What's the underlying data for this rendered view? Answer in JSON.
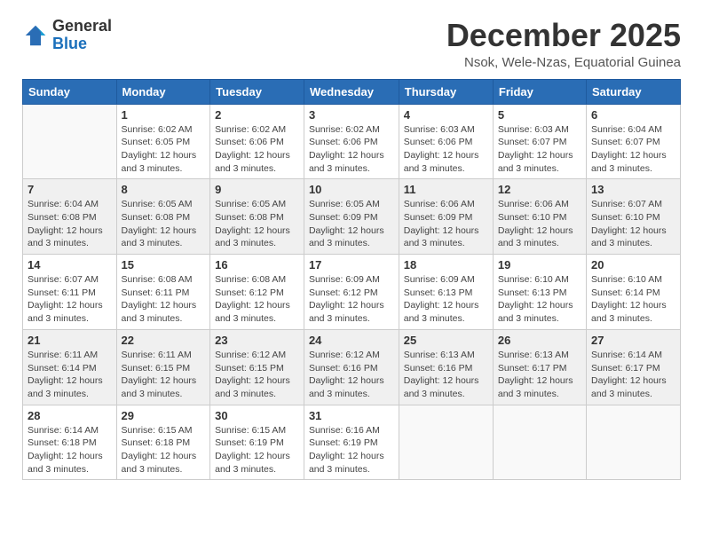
{
  "logo": {
    "general": "General",
    "blue": "Blue"
  },
  "header": {
    "month": "December 2025",
    "location": "Nsok, Wele-Nzas, Equatorial Guinea"
  },
  "days_of_week": [
    "Sunday",
    "Monday",
    "Tuesday",
    "Wednesday",
    "Thursday",
    "Friday",
    "Saturday"
  ],
  "weeks": [
    [
      {
        "day": "",
        "info": ""
      },
      {
        "day": "1",
        "info": "Sunrise: 6:02 AM\nSunset: 6:05 PM\nDaylight: 12 hours\nand 3 minutes."
      },
      {
        "day": "2",
        "info": "Sunrise: 6:02 AM\nSunset: 6:06 PM\nDaylight: 12 hours\nand 3 minutes."
      },
      {
        "day": "3",
        "info": "Sunrise: 6:02 AM\nSunset: 6:06 PM\nDaylight: 12 hours\nand 3 minutes."
      },
      {
        "day": "4",
        "info": "Sunrise: 6:03 AM\nSunset: 6:06 PM\nDaylight: 12 hours\nand 3 minutes."
      },
      {
        "day": "5",
        "info": "Sunrise: 6:03 AM\nSunset: 6:07 PM\nDaylight: 12 hours\nand 3 minutes."
      },
      {
        "day": "6",
        "info": "Sunrise: 6:04 AM\nSunset: 6:07 PM\nDaylight: 12 hours\nand 3 minutes."
      }
    ],
    [
      {
        "day": "7",
        "info": "Sunrise: 6:04 AM\nSunset: 6:08 PM\nDaylight: 12 hours\nand 3 minutes."
      },
      {
        "day": "8",
        "info": "Sunrise: 6:05 AM\nSunset: 6:08 PM\nDaylight: 12 hours\nand 3 minutes."
      },
      {
        "day": "9",
        "info": "Sunrise: 6:05 AM\nSunset: 6:08 PM\nDaylight: 12 hours\nand 3 minutes."
      },
      {
        "day": "10",
        "info": "Sunrise: 6:05 AM\nSunset: 6:09 PM\nDaylight: 12 hours\nand 3 minutes."
      },
      {
        "day": "11",
        "info": "Sunrise: 6:06 AM\nSunset: 6:09 PM\nDaylight: 12 hours\nand 3 minutes."
      },
      {
        "day": "12",
        "info": "Sunrise: 6:06 AM\nSunset: 6:10 PM\nDaylight: 12 hours\nand 3 minutes."
      },
      {
        "day": "13",
        "info": "Sunrise: 6:07 AM\nSunset: 6:10 PM\nDaylight: 12 hours\nand 3 minutes."
      }
    ],
    [
      {
        "day": "14",
        "info": "Sunrise: 6:07 AM\nSunset: 6:11 PM\nDaylight: 12 hours\nand 3 minutes."
      },
      {
        "day": "15",
        "info": "Sunrise: 6:08 AM\nSunset: 6:11 PM\nDaylight: 12 hours\nand 3 minutes."
      },
      {
        "day": "16",
        "info": "Sunrise: 6:08 AM\nSunset: 6:12 PM\nDaylight: 12 hours\nand 3 minutes."
      },
      {
        "day": "17",
        "info": "Sunrise: 6:09 AM\nSunset: 6:12 PM\nDaylight: 12 hours\nand 3 minutes."
      },
      {
        "day": "18",
        "info": "Sunrise: 6:09 AM\nSunset: 6:13 PM\nDaylight: 12 hours\nand 3 minutes."
      },
      {
        "day": "19",
        "info": "Sunrise: 6:10 AM\nSunset: 6:13 PM\nDaylight: 12 hours\nand 3 minutes."
      },
      {
        "day": "20",
        "info": "Sunrise: 6:10 AM\nSunset: 6:14 PM\nDaylight: 12 hours\nand 3 minutes."
      }
    ],
    [
      {
        "day": "21",
        "info": "Sunrise: 6:11 AM\nSunset: 6:14 PM\nDaylight: 12 hours\nand 3 minutes."
      },
      {
        "day": "22",
        "info": "Sunrise: 6:11 AM\nSunset: 6:15 PM\nDaylight: 12 hours\nand 3 minutes."
      },
      {
        "day": "23",
        "info": "Sunrise: 6:12 AM\nSunset: 6:15 PM\nDaylight: 12 hours\nand 3 minutes."
      },
      {
        "day": "24",
        "info": "Sunrise: 6:12 AM\nSunset: 6:16 PM\nDaylight: 12 hours\nand 3 minutes."
      },
      {
        "day": "25",
        "info": "Sunrise: 6:13 AM\nSunset: 6:16 PM\nDaylight: 12 hours\nand 3 minutes."
      },
      {
        "day": "26",
        "info": "Sunrise: 6:13 AM\nSunset: 6:17 PM\nDaylight: 12 hours\nand 3 minutes."
      },
      {
        "day": "27",
        "info": "Sunrise: 6:14 AM\nSunset: 6:17 PM\nDaylight: 12 hours\nand 3 minutes."
      }
    ],
    [
      {
        "day": "28",
        "info": "Sunrise: 6:14 AM\nSunset: 6:18 PM\nDaylight: 12 hours\nand 3 minutes."
      },
      {
        "day": "29",
        "info": "Sunrise: 6:15 AM\nSunset: 6:18 PM\nDaylight: 12 hours\nand 3 minutes."
      },
      {
        "day": "30",
        "info": "Sunrise: 6:15 AM\nSunset: 6:19 PM\nDaylight: 12 hours\nand 3 minutes."
      },
      {
        "day": "31",
        "info": "Sunrise: 6:16 AM\nSunset: 6:19 PM\nDaylight: 12 hours\nand 3 minutes."
      },
      {
        "day": "",
        "info": ""
      },
      {
        "day": "",
        "info": ""
      },
      {
        "day": "",
        "info": ""
      }
    ]
  ]
}
